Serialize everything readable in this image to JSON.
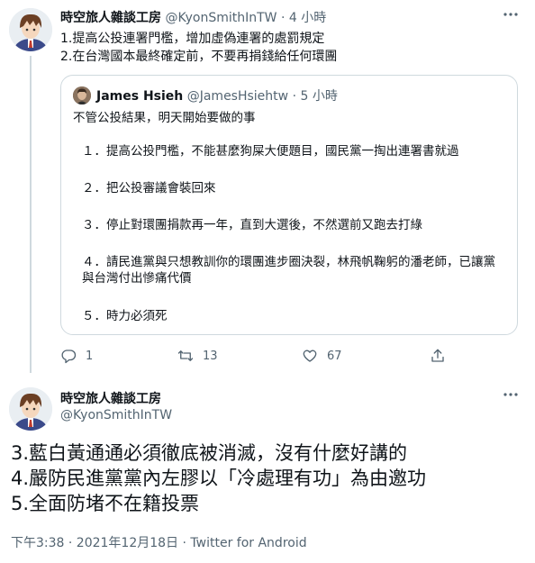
{
  "tweet1": {
    "author_name": "時空旅人雜談工房",
    "author_handle": "@KyonSmithInTW",
    "separator": "·",
    "time": "4 小時",
    "lines": [
      "1.提高公投連署門檻，增加虛偽連署的處罰規定",
      "2.在台灣國本最終確定前，不要再捐錢給任何環團"
    ]
  },
  "quote": {
    "author_name": "James Hsieh",
    "author_handle": "@JamesHsiehtw",
    "separator": "·",
    "time": "5 小時",
    "lines": [
      "不管公投結果，明天開始要做的事",
      "１．提高公投門檻，不能甚麼狗屎大便題目，國民黨一掏出連署書就過",
      "２．把公投審議會裝回來",
      "３．停止對環團捐款再一年，直到大選後，不然選前又跑去打綠",
      "４．請民進黨與只想教訓你的環團進步圈決裂，林飛帆鞠躬的潘老師，已讓黨與台灣付出慘痛代價",
      "５．時力必須死"
    ]
  },
  "actions": {
    "reply_count": "1",
    "retweet_count": "13",
    "like_count": "67"
  },
  "tweet2": {
    "author_name": "時空旅人雜談工房",
    "author_handle": "@KyonSmithInTW",
    "lines": [
      "3.藍白黃通通必須徹底被消滅，沒有什麼好講的",
      "4.嚴防民進黨黨內左膠以「冷處理有功」為由邀功",
      "5.全面防堵不在籍投票"
    ],
    "timestamp": "下午3:38 · 2021年12月18日 · ",
    "client": "Twitter for Android"
  },
  "colors": {
    "text": "#0f1419",
    "secondary": "#536471",
    "border": "#cfd9de"
  },
  "icons": [
    "more-icon",
    "reply-icon",
    "retweet-icon",
    "like-icon",
    "share-icon"
  ]
}
